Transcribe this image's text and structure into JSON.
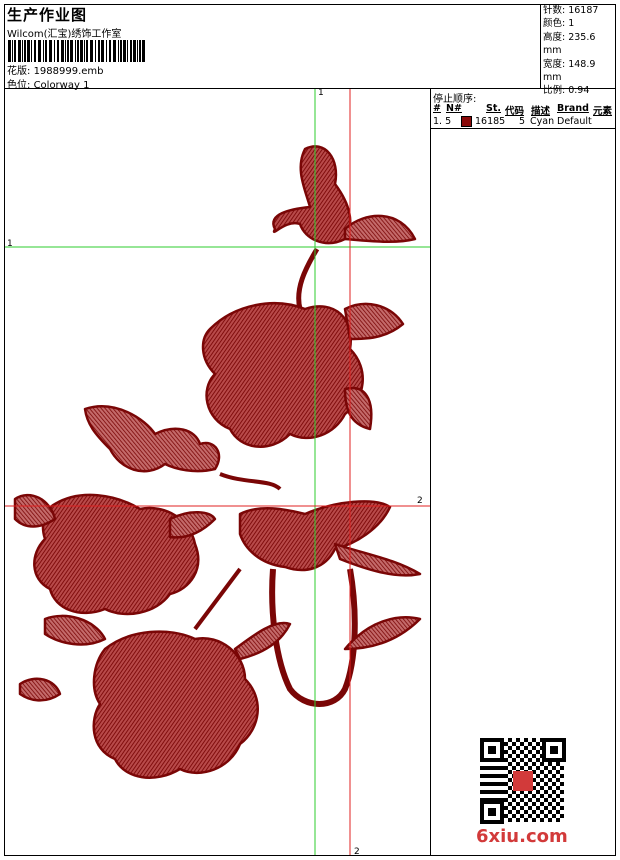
{
  "header": {
    "title": "生产作业图",
    "company": "Wilcom(汇宝)绣饰工作室",
    "file_label": "花版:",
    "file_name": "1988999.emb",
    "colorway_label": "色位:",
    "colorway": "Colorway 1"
  },
  "stats": {
    "stitches": "针数: 16187",
    "colors": "颜色: 1",
    "height": "高度: 235.6 mm",
    "width": "宽度: 148.9 mm",
    "scale": "比例: 0.94"
  },
  "stop_sequence": {
    "title": "停止顺序:",
    "columns": [
      "#",
      "N#",
      "St.",
      "代码",
      "描述",
      "Brand",
      "元素"
    ],
    "rows": [
      {
        "index": "1. 5",
        "stitches": "16185",
        "code": "5",
        "desc": "Cyan",
        "brand": "Default",
        "color": "#8b0a0a"
      }
    ]
  },
  "guides": {
    "v1_label": "1",
    "h1_label": "1",
    "h2_label": "2",
    "v2_label": "2"
  },
  "colors": {
    "thread": "#8b0a0a",
    "guide_green": "#2ecc2e",
    "guide_red": "#e02020"
  },
  "watermark": "6xiu.com"
}
